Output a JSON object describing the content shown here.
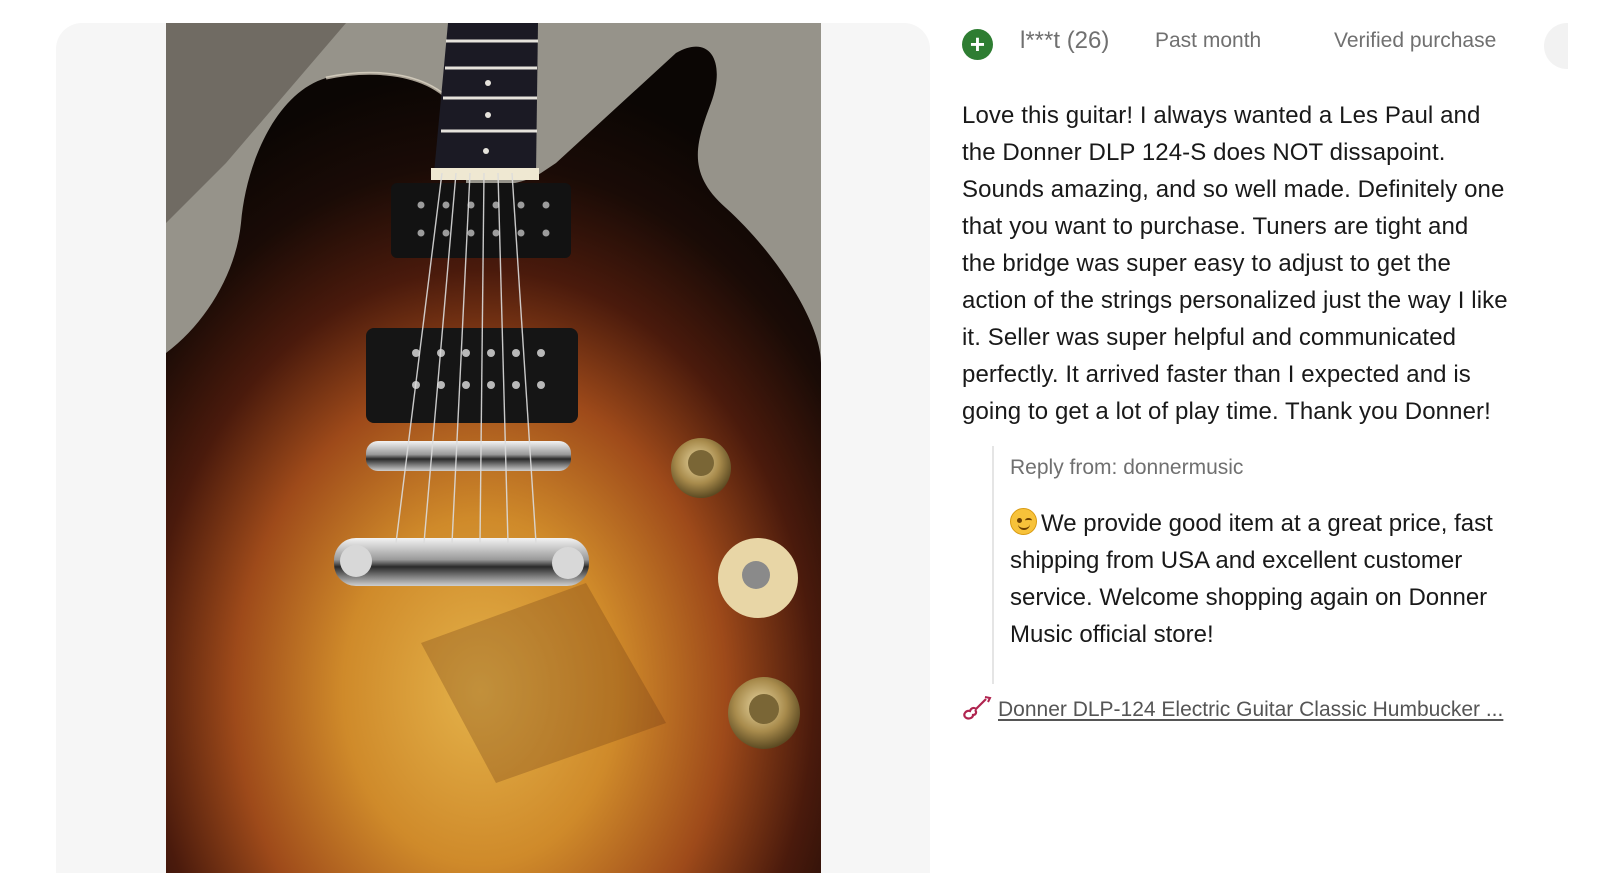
{
  "reviewer": {
    "badge_icon": "plus-icon",
    "badge_color": "#2e7d32",
    "name": "l***t (26)",
    "when": "Past month",
    "verified": "Verified purchase"
  },
  "review": {
    "lines": [
      "Love this guitar! I always wanted a Les Paul and",
      "the Donner DLP 124-S does NOT dissapoint.",
      "Sounds amazing, and so well made. Definitely one",
      "that you want to purchase. Tuners are tight and",
      "the bridge was super easy to adjust to get the",
      "action of the strings personalized just the way I like",
      "it. Seller was super helpful and communicated",
      "perfectly. It arrived faster than I expected and is",
      "going to get a lot of play time. Thank you Donner!"
    ]
  },
  "reply": {
    "from": "Reply from: donnermusic",
    "emoji_icon": "winking-face-icon",
    "lines": [
      "We provide good item at a great price, fast",
      "shipping from USA and excellent customer",
      "service. Welcome shopping again on Donner",
      "Music official store!"
    ]
  },
  "product": {
    "icon": "guitar-icon",
    "link_text": "Donner DLP-124 Electric Guitar Classic Humbucker ..."
  },
  "photo": {
    "subject": "guitar-photo"
  }
}
